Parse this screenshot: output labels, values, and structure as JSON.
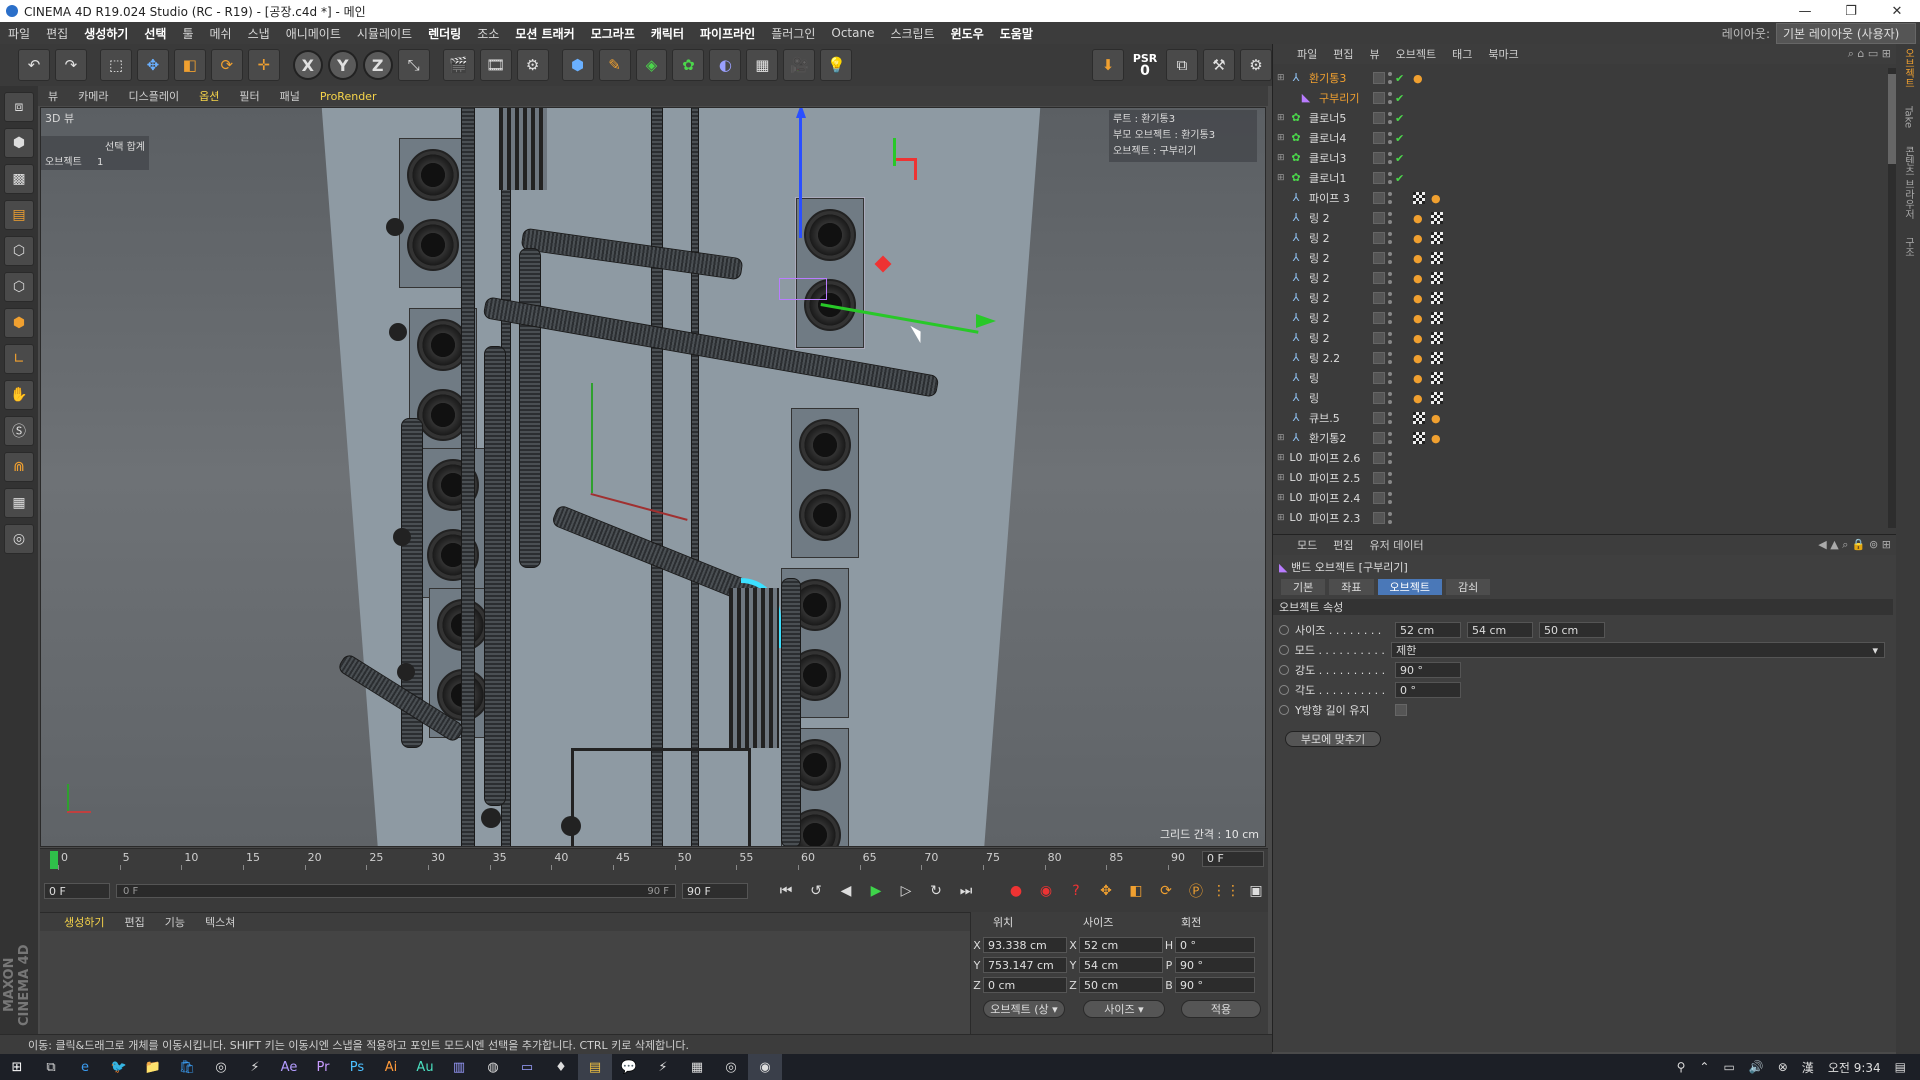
{
  "window": {
    "title": "CINEMA 4D R19.024 Studio (RC - R19) - [공장.c4d *] - 메인"
  },
  "menubar": {
    "items": [
      "파일",
      "편집",
      "생성하기",
      "선택",
      "툴",
      "메쉬",
      "스냅",
      "애니메이트",
      "시뮬레이트",
      "렌더링",
      "조소",
      "모션 트래커",
      "모그라프",
      "캐릭터",
      "파이프라인",
      "플러그인",
      "Octane",
      "스크립트",
      "윈도우",
      "도움말"
    ],
    "highlight": [
      2,
      3,
      9,
      11,
      12,
      13,
      14,
      18,
      19
    ],
    "layout_label": "레이아웃:",
    "layout_value": "기본 레이아웃 (사용자)"
  },
  "toolbar": {
    "psr_label": "PSR",
    "psr_value": "0",
    "x": "X",
    "y": "Y",
    "z": "Z"
  },
  "viewport_menu": [
    "뷰",
    "카메라",
    "디스플레이",
    "옵션",
    "필터",
    "패널",
    "ProRender"
  ],
  "viewport": {
    "label": "3D 뷰",
    "sel_total_label": "선택 합계",
    "sel_object_label": "오브젝트",
    "sel_object_count": "1",
    "info_root": "루트 : 환기통3",
    "info_parent": "부모 오브젝트 : 환기통3",
    "info_object": "오브젝트 : 구부리기",
    "grid_spacing": "그리드 간격 : 10 cm"
  },
  "timeline": {
    "ticks": [
      "0",
      "5",
      "10",
      "15",
      "20",
      "25",
      "30",
      "35",
      "40",
      "45",
      "50",
      "55",
      "60",
      "65",
      "70",
      "75",
      "80",
      "85",
      "90"
    ],
    "end_box": "0 F"
  },
  "playbar": {
    "start": "0 F",
    "slider_left": "0 F",
    "slider_right": "90 F",
    "end": "90 F"
  },
  "material_menu": [
    "생성하기",
    "편집",
    "기능",
    "텍스쳐"
  ],
  "coords": {
    "head_pos": "위치",
    "head_size": "사이즈",
    "head_rot": "회전",
    "rows": [
      {
        "a": "X",
        "pos": "93.338 cm",
        "b": "X",
        "size": "52 cm",
        "c": "H",
        "rot": "0 °"
      },
      {
        "a": "Y",
        "pos": "753.147 cm",
        "b": "Y",
        "size": "54 cm",
        "c": "P",
        "rot": "90 °"
      },
      {
        "a": "Z",
        "pos": "0 cm",
        "b": "Z",
        "size": "50 cm",
        "c": "B",
        "rot": "90 °"
      }
    ],
    "mode_button": "오브젝트 (상",
    "size_button": "사이즈",
    "apply_button": "적용"
  },
  "statusbar": {
    "text": "이동: 클릭&드래그로 개체를 이동시킵니다. SHIFT 키는 이동시엔 스냅을 적용하고 포인트 모드시엔 선택을 추가합니다. CTRL 키로 삭제합니다."
  },
  "object_manager": {
    "menu": [
      "파일",
      "편집",
      "뷰",
      "오브젝트",
      "태그",
      "북마크"
    ],
    "objects": [
      {
        "name": "환기통3",
        "icon": "null-icon",
        "selected": true,
        "indent": 0
      },
      {
        "name": "구부리기",
        "icon": "bend-icon",
        "selected": true,
        "indent": 1
      },
      {
        "name": "클로너5",
        "icon": "cloner-icon",
        "indent": 0
      },
      {
        "name": "클로너4",
        "icon": "cloner-icon",
        "indent": 0
      },
      {
        "name": "클로너3",
        "icon": "cloner-icon",
        "indent": 0
      },
      {
        "name": "클로너1",
        "icon": "cloner-icon",
        "indent": 0
      },
      {
        "name": "파이프 3",
        "icon": "pipe-icon",
        "indent": 0
      },
      {
        "name": "링 2",
        "icon": "ring-icon",
        "indent": 0
      },
      {
        "name": "링 2",
        "icon": "ring-icon",
        "indent": 0
      },
      {
        "name": "링 2",
        "icon": "ring-icon",
        "indent": 0
      },
      {
        "name": "링 2",
        "icon": "ring-icon",
        "indent": 0
      },
      {
        "name": "링 2",
        "icon": "ring-icon",
        "indent": 0
      },
      {
        "name": "링 2",
        "icon": "ring-icon",
        "indent": 0
      },
      {
        "name": "링 2",
        "icon": "ring-icon",
        "indent": 0
      },
      {
        "name": "링 2.2",
        "icon": "ring-icon",
        "indent": 0
      },
      {
        "name": "링",
        "icon": "ring-icon",
        "indent": 0
      },
      {
        "name": "링",
        "icon": "ring-icon",
        "indent": 0
      },
      {
        "name": "큐브.5",
        "icon": "cube-icon",
        "indent": 0
      },
      {
        "name": "환기통2",
        "icon": "null-icon",
        "indent": 0
      },
      {
        "name": "파이프 2.6",
        "icon": "lo-icon",
        "indent": 0
      },
      {
        "name": "파이프 2.5",
        "icon": "lo-icon",
        "indent": 0
      },
      {
        "name": "파이프 2.4",
        "icon": "lo-icon",
        "indent": 0
      },
      {
        "name": "파이프 2.3",
        "icon": "lo-icon",
        "indent": 0
      }
    ]
  },
  "attribute_manager": {
    "menu": [
      "모드",
      "편집",
      "유저 데이터"
    ],
    "object_title": "밴드 오브젝트 [구부리기]",
    "tabs": [
      "기본",
      "좌표",
      "오브젝트",
      "감쇠"
    ],
    "active_tab": 2,
    "section": "오브젝트 속성",
    "size_label": "사이즈 . . . . . . . .",
    "size_x": "52 cm",
    "size_y": "54 cm",
    "size_z": "50 cm",
    "mode_label": "모드 . . . . . . . . . .",
    "mode_value": "제한",
    "strength_label": "강도 . . . . . . . . . .",
    "strength_value": "90 °",
    "angle_label": "각도 . . . . . . . . . .",
    "angle_value": "0 °",
    "keep_y_label": "Y방향 길이 유지",
    "fit_button": "부모에 맞추기"
  },
  "right_tabs": [
    "오브젝트",
    "Take",
    "콘텐츠 브라우저",
    "구조"
  ],
  "taskbar": {
    "time": "오전 9:34"
  },
  "colors": {
    "accent": "#4a78b8",
    "selected": "#f0a030",
    "play": "#3ed44a"
  }
}
